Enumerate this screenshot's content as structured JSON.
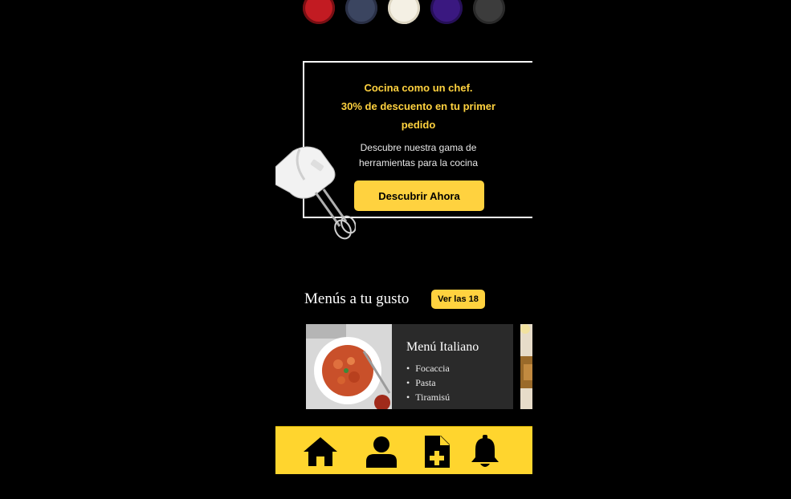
{
  "banner": {
    "title_line1": "Cocina como un chef.",
    "title_line2": "30% de descuento en tu primer",
    "title_line3": "pedido",
    "subtitle_line1": "Descubre nuestra gama de",
    "subtitle_line2": "herramientas para la cocina",
    "cta_label": "Descubrir Ahora"
  },
  "menus": {
    "section_title": "Menús a tu gusto",
    "see_all_label": "Ver las 18",
    "cards": [
      {
        "title": "Menú Italiano",
        "items": [
          "Focaccia",
          "Pasta",
          "Tiramisú"
        ]
      }
    ]
  },
  "nav": {
    "items": [
      {
        "icon": "home-icon"
      },
      {
        "icon": "user-icon"
      },
      {
        "icon": "add-document-icon"
      },
      {
        "icon": "bell-icon"
      }
    ]
  },
  "colors": {
    "accent": "#ffd23f",
    "background": "#000000",
    "card": "#2a2a2a"
  }
}
